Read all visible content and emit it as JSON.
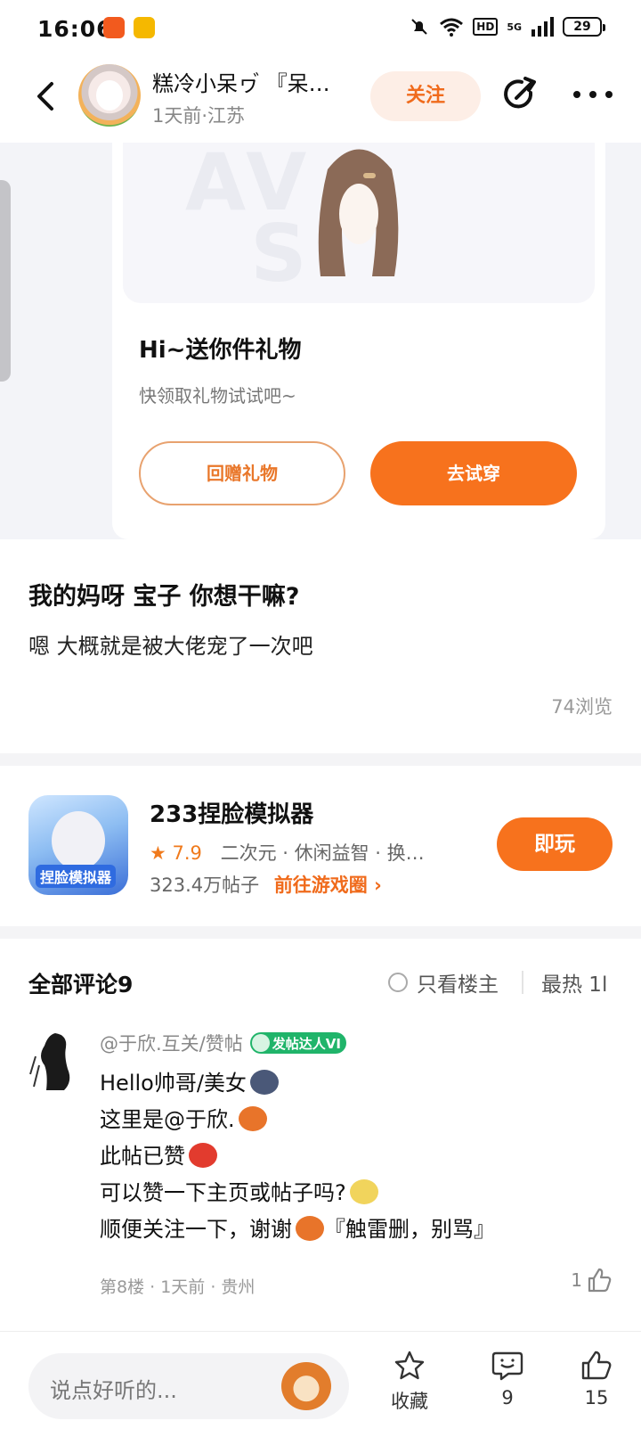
{
  "status_bar": {
    "time": "16:06",
    "hd": "HD",
    "net": "5G",
    "battery": "29"
  },
  "header": {
    "username": "糕冷小呆ヮ゙ 『呆…",
    "meta": "1天前·江苏",
    "follow_label": "关注"
  },
  "gift": {
    "title": "Hi~送你件礼物",
    "subtitle": "快领取礼物试试吧~",
    "return_label": "回赠礼物",
    "try_label": "去试穿"
  },
  "post": {
    "title": "我的妈呀 宝子 你想干嘛?",
    "body": "嗯 大概就是被大佬宠了一次吧",
    "views": "74浏览"
  },
  "game": {
    "icon_label": "捏脸模拟器",
    "name": "233捏脸模拟器",
    "star": "★",
    "rating": "7.9",
    "tags": "二次元 · 休闲益智 · 换…",
    "posts": "323.4万帖子",
    "goto": "前往游戏圈 ›",
    "play_label": "即玩"
  },
  "comments": {
    "header": "全部评论9",
    "only_owner": "只看楼主",
    "sort": "最热 1l",
    "items": [
      {
        "user": "@于欣.互关/赞帖",
        "badge": "发帖达人VI",
        "lines": [
          "Hello帅哥/美女",
          "这里是@于欣.",
          "此帖已赞",
          "可以赞一下主页或帖子吗?",
          "顺便关注一下，谢谢",
          "『触雷删，别骂』"
        ],
        "meta": "第8楼 · 1天前 · 贵州",
        "likes": "1"
      }
    ]
  },
  "bottom_bar": {
    "placeholder": "说点好听的...",
    "collect_label": "收藏",
    "comment_count": "9",
    "like_count": "15"
  },
  "colors": {
    "accent": "#f7721d",
    "follow_bg": "#fdeee6",
    "badge_green": "#20b46a"
  },
  "icons": [
    "back-icon",
    "share-icon",
    "more-icon",
    "star-icon",
    "comment-icon",
    "thumb-up-icon"
  ]
}
